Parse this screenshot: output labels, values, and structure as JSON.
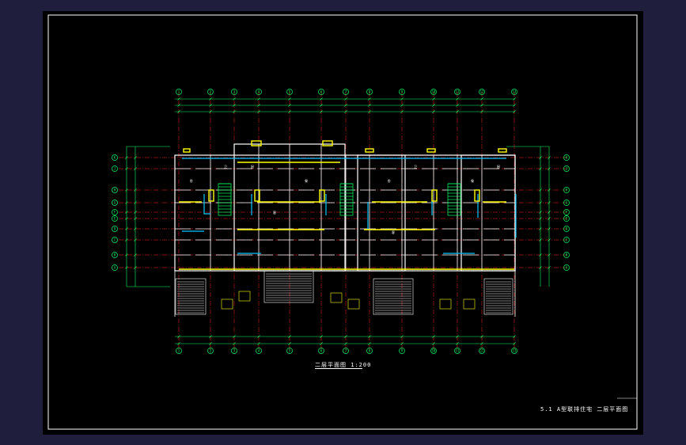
{
  "drawing": {
    "title": "二层平面图 1:200",
    "title_block": "5.1  A型联排住宅  二层平面图",
    "colors": {
      "background": "#000000",
      "frame": "#ffffff",
      "axis": "#ff2020",
      "dimension": "#00ff66",
      "wall": "#ffffff",
      "window": "#00c8ff",
      "fixture": "#ffff00",
      "stair": "#00ff66"
    },
    "grid_columns": [
      "1",
      "2",
      "3",
      "4",
      "5",
      "6",
      "7",
      "8",
      "9",
      "10",
      "11",
      "12",
      "13"
    ],
    "grid_rows": [
      "A",
      "B",
      "C",
      "D",
      "E",
      "F",
      "G",
      "H",
      "J",
      "K"
    ],
    "room_labels": [
      "卧",
      "卫",
      "客",
      "餐",
      "厨",
      "卧",
      "卫",
      "客",
      "餐",
      "厨"
    ]
  }
}
